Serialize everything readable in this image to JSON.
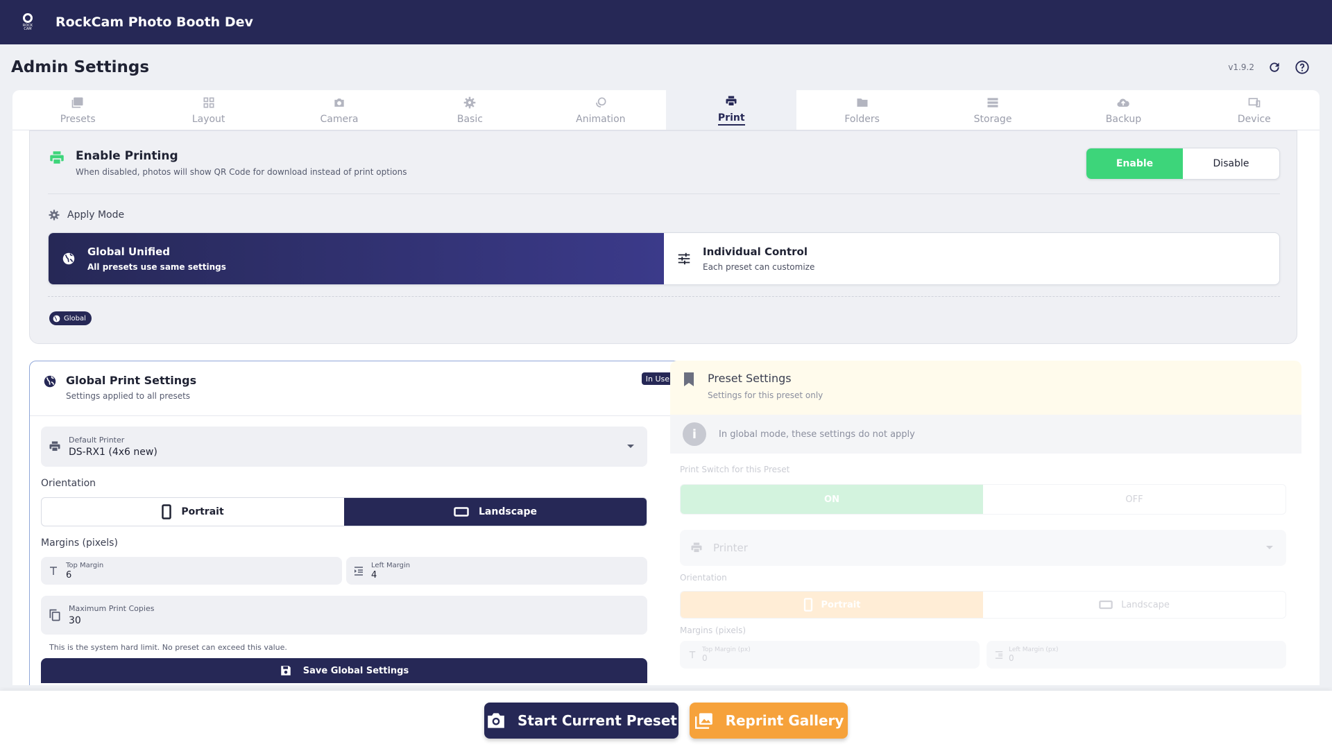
{
  "app": {
    "title": "RockCam Photo Booth Dev",
    "logo_text": "ROCK CAM"
  },
  "header": {
    "title": "Admin Settings",
    "version": "v1.9.2"
  },
  "tabs": [
    {
      "label": "Presets",
      "icon": "image-icon"
    },
    {
      "label": "Layout",
      "icon": "grid-icon"
    },
    {
      "label": "Camera",
      "icon": "camera-icon"
    },
    {
      "label": "Basic",
      "icon": "gear-icon"
    },
    {
      "label": "Animation",
      "icon": "animation-icon"
    },
    {
      "label": "Print",
      "icon": "printer-icon",
      "active": true
    },
    {
      "label": "Folders",
      "icon": "folder-icon"
    },
    {
      "label": "Storage",
      "icon": "storage-icon"
    },
    {
      "label": "Backup",
      "icon": "cloud-upload-icon"
    },
    {
      "label": "Device",
      "icon": "devices-icon"
    }
  ],
  "enable_printing": {
    "title": "Enable Printing",
    "subtitle": "When disabled, photos will show QR Code for download instead of print options",
    "enable_label": "Enable",
    "disable_label": "Disable",
    "enabled": true
  },
  "apply_mode": {
    "label": "Apply Mode",
    "global_title": "Global Unified",
    "global_sub": "All presets use same settings",
    "individual_title": "Individual Control",
    "individual_sub": "Each preset can customize",
    "badge": "Global"
  },
  "global_print": {
    "title": "Global Print Settings",
    "subtitle": "Settings applied to all presets",
    "badge": "In Use",
    "printer_label": "Default Printer",
    "printer_value": "DS-RX1 (4x6 new)",
    "orientation_label": "Orientation",
    "portrait_label": "Portrait",
    "landscape_label": "Landscape",
    "orientation_selected": "Landscape",
    "margins_label": "Margins (pixels)",
    "top_margin_label": "Top Margin",
    "top_margin_value": "6",
    "left_margin_label": "Left Margin",
    "left_margin_value": "4",
    "copies_label": "Maximum Print Copies",
    "copies_value": "30",
    "hint": "This is the system hard limit. No preset can exceed this value.",
    "save_label": "Save Global Settings"
  },
  "preset_settings": {
    "title": "Preset Settings",
    "subtitle": "Settings for this preset only",
    "info": "In global mode, these settings do not apply",
    "switch_label": "Print Switch for this Preset",
    "on_label": "ON",
    "off_label": "OFF",
    "printer_placeholder": "Printer",
    "orientation_label": "Orientation",
    "portrait_label": "Portrait",
    "landscape_label": "Landscape",
    "margins_label": "Margins (pixels)",
    "top_margin_label": "Top Margin (px)",
    "top_margin_value": "0",
    "left_margin_label": "Left Margin (px)",
    "left_margin_value": "0"
  },
  "bottom": {
    "start_label": "Start Current Preset",
    "reprint_label": "Reprint Gallery"
  },
  "colors": {
    "navy": "#262856",
    "enable_green": "#3dd57a",
    "reprint_orange": "#f6a23b"
  }
}
